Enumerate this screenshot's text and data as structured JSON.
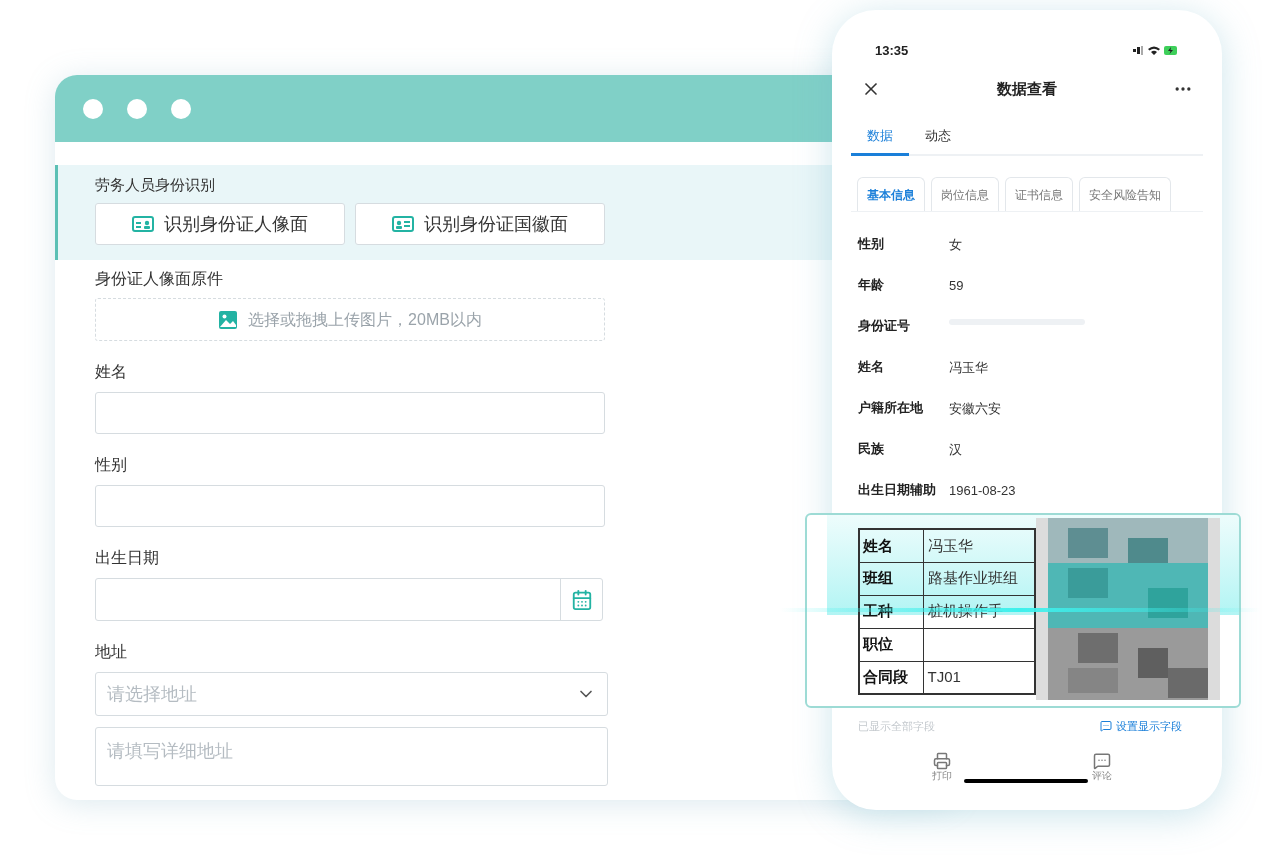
{
  "form_window": {
    "section": {
      "title": "劳务人员身份识别",
      "buttons": [
        {
          "label": "识别身份证人像面",
          "kind": "portrait"
        },
        {
          "label": "识别身份证国徽面",
          "kind": "emblem"
        }
      ]
    },
    "upload": {
      "label": "身份证人像面原件",
      "hint": "选择或拖拽上传图片，20MB以内"
    },
    "fields": [
      {
        "label": "姓名",
        "kind": "text"
      },
      {
        "label": "性别",
        "kind": "text"
      },
      {
        "label": "出生日期",
        "kind": "date"
      },
      {
        "label": "地址",
        "kind": "address",
        "placeholder": "请选择地址",
        "detail_placeholder": "请填写详细地址"
      }
    ]
  },
  "phone": {
    "time": "13:35",
    "title": "数据查看",
    "tabs": [
      {
        "label": "数据",
        "selected": true
      },
      {
        "label": "动态",
        "selected": false
      }
    ],
    "sub_tabs": [
      {
        "label": "基本信息",
        "selected": true
      },
      {
        "label": "岗位信息",
        "selected": false
      },
      {
        "label": "证书信息",
        "selected": false
      },
      {
        "label": "安全风险告知",
        "selected": false
      }
    ],
    "rows": [
      {
        "label": "性别",
        "value": "女"
      },
      {
        "label": "年龄",
        "value": "59"
      },
      {
        "label": "身份证号",
        "kind": "redacted"
      },
      {
        "label": "姓名",
        "value": "冯玉华"
      },
      {
        "label": "户籍所在地",
        "value": "安徽六安"
      },
      {
        "label": "民族",
        "value": "汉"
      },
      {
        "label": "出生日期辅助",
        "value": "1961-08-23"
      }
    ],
    "footer": {
      "status": "已显示全部字段",
      "link": "设置显示字段"
    },
    "bottom_bar": [
      {
        "label": "打印",
        "kind": "print"
      },
      {
        "label": "评论",
        "kind": "comment"
      }
    ]
  },
  "scan_card": {
    "rows": [
      {
        "label": "姓名",
        "value": "冯玉华"
      },
      {
        "label": "班组",
        "value": "路基作业班组"
      },
      {
        "label": "工种",
        "value": "桩机操作手"
      },
      {
        "label": "职位"
      },
      {
        "label": "合同段",
        "value": "TJ01"
      }
    ]
  }
}
